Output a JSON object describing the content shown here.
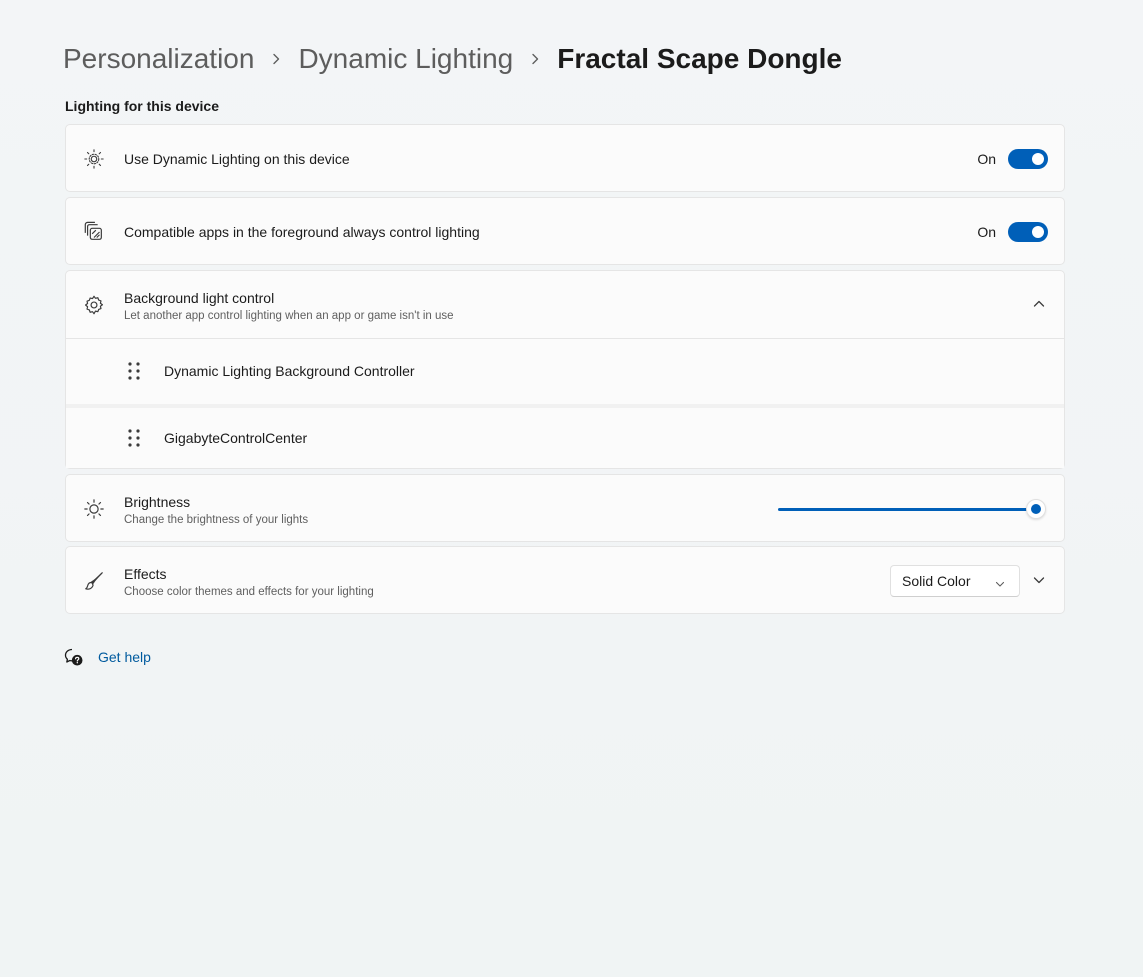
{
  "breadcrumb": {
    "items": [
      "Personalization",
      "Dynamic Lighting",
      "Fractal Scape Dongle"
    ]
  },
  "section": {
    "label": "Lighting for this device"
  },
  "settings": {
    "use_dynamic_lighting": {
      "title": "Use Dynamic Lighting on this device",
      "state": "On",
      "icon": "sun-rays-icon"
    },
    "foreground_apps": {
      "title": "Compatible apps in the foreground always control lighting",
      "state": "On",
      "icon": "stacked-squares-icon"
    },
    "background_control": {
      "title": "Background light control",
      "subtitle": "Let another app control lighting when an app or game isn't in use",
      "icon": "gear-icon",
      "items": [
        {
          "label": "Dynamic Lighting Background Controller"
        },
        {
          "label": "GigabyteControlCenter"
        }
      ]
    },
    "brightness": {
      "title": "Brightness",
      "subtitle": "Change the brightness of your lights",
      "icon": "sun-icon",
      "value_percent": 100
    },
    "effects": {
      "title": "Effects",
      "subtitle": "Choose color themes and effects for your lighting",
      "icon": "brush-icon",
      "selected": "Solid Color"
    }
  },
  "help": {
    "label": "Get help"
  },
  "colors": {
    "accent": "#005fb8",
    "link": "#005a9e",
    "card": "#fbfbfb",
    "border": "#e5e5e5"
  }
}
